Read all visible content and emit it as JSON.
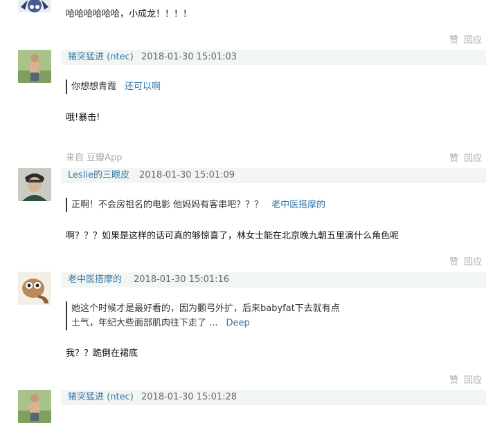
{
  "comments": [
    {
      "text": "哈哈哈哈哈哈，小成龙！！！！",
      "like": "赞",
      "reply": "回应"
    },
    {
      "author": "猪突猛进",
      "handle": "(ntec)",
      "time": "2018-01-30 15:01:03",
      "quote": "你想想青霞",
      "quote_author": "还可以啊",
      "text": "哦!暴击!",
      "source": "来自 豆瓣App",
      "like": "赞",
      "reply": "回应"
    },
    {
      "author": "Leslie的三眼皮",
      "time": "2018-01-30 15:01:09",
      "quote": "正啊！不会房祖名的电影 他妈妈有客串吧？？？",
      "quote_author": "老中医搭摩的",
      "text": "啊？？？如果是这样的话可真的够惊喜了，林女士能在北京晚九朝五里演什么角色呢",
      "like": "赞",
      "reply": "回应"
    },
    {
      "author": "老中医搭摩的",
      "time": "2018-01-30 15:01:16",
      "quote_line1": "她这个时候才是最好看的，因为颧弓外扩，后来babyfat下去就有点",
      "quote_line2": "土气，年纪大些面部肌肉往下走了 ...",
      "quote_author": "Deep",
      "text": "我？？跪倒在裙底",
      "like": "赞",
      "reply": "回应"
    },
    {
      "author": "猪突猛进",
      "handle": "(ntec)",
      "time": "2018-01-30 15:01:28"
    }
  ],
  "icons": {
    "avatar_1": "cartoon-avatar-icon",
    "avatar_2": "person-outdoor-avatar-icon",
    "avatar_3": "man-portrait-avatar-icon",
    "avatar_4": "lemur-avatar-icon"
  }
}
